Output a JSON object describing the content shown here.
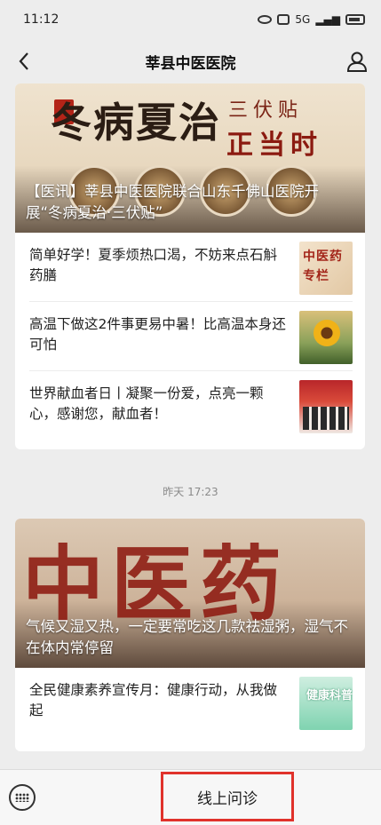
{
  "status_bar": {
    "time": "11:12",
    "network": "5G"
  },
  "nav": {
    "title": "莘县中医医院"
  },
  "card1": {
    "cover": {
      "art_main": "冬病夏治",
      "art_sub1": "三伏贴",
      "art_sub2": "正当时",
      "title": "【医讯】莘县中医医院联合山东千佛山医院开展“冬病夏治·三伏贴”"
    },
    "items": [
      {
        "text": "简单好学！夏季烦热口渴，不妨来点石斛药膳",
        "thumb_text": "中医药专栏"
      },
      {
        "text": "高温下做这2件事更易中暑！比高温本身还可怕"
      },
      {
        "text": "世界献血者日丨凝聚一份爱，点亮一颗心，感谢您，献血者！"
      }
    ]
  },
  "timestamp": "昨天 17:23",
  "card2": {
    "cover": {
      "art_main": "中医药",
      "title": "气候又湿又热，一定要常吃这几款祛湿粥，湿气不在体内常停留"
    },
    "items": [
      {
        "text": "全民健康素养宣传月：健康行动，从我做起",
        "thumb_text": "健康科普"
      }
    ]
  },
  "bottom_bar": {
    "menu_label": "线上问诊",
    "highlight_color": "#e0322b"
  }
}
